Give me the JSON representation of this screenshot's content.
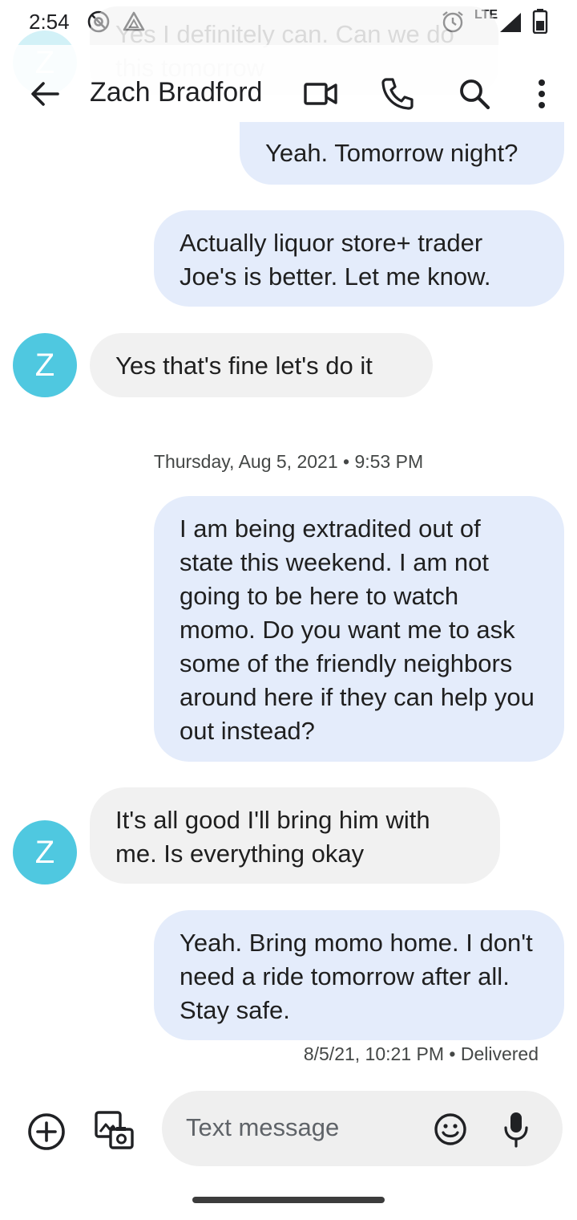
{
  "status_bar": {
    "time": "2:54",
    "network": "LTE"
  },
  "ghost": {
    "avatar_letter": "Z",
    "message": "Yes I definitely can. Can we do this tomorrow"
  },
  "header": {
    "contact_name": "Zach Bradford",
    "back_icon": "arrow-back",
    "video_icon": "videocam",
    "call_icon": "phone",
    "search_icon": "search",
    "more_icon": "more-vert"
  },
  "messages": [
    {
      "direction": "outgoing",
      "text": "Yeah. Tomorrow night?"
    },
    {
      "direction": "outgoing",
      "text": "Actually liquor store+ trader Joe's is better. Let me know."
    },
    {
      "direction": "incoming",
      "avatar": "Z",
      "text": "Yes that's fine let's do it"
    },
    {
      "direction": "outgoing",
      "text": "I am being extradited out of state this weekend. I am not going to be here to watch momo. Do you want me to ask some of the friendly neighbors around here if they can help you out instead?"
    },
    {
      "direction": "incoming",
      "avatar": "Z",
      "text": "It's all good I'll bring him with me. Is everything okay"
    },
    {
      "direction": "outgoing",
      "text": "Yeah. Bring momo home. I don't need a ride tomorrow after all. Stay safe."
    }
  ],
  "date_divider": "Thursday, Aug 5, 2021 • 9:53 PM",
  "last_message_meta": "8/5/21, 10:21 PM • Delivered",
  "composer": {
    "placeholder": "Text message",
    "add_icon": "add-circle",
    "gallery_icon": "gallery-camera",
    "emoji_icon": "emoji",
    "mic_icon": "mic"
  },
  "colors": {
    "outgoing_bubble": "#e4ecfb",
    "incoming_bubble": "#f1f1f1",
    "avatar": "#4fc8e0"
  }
}
